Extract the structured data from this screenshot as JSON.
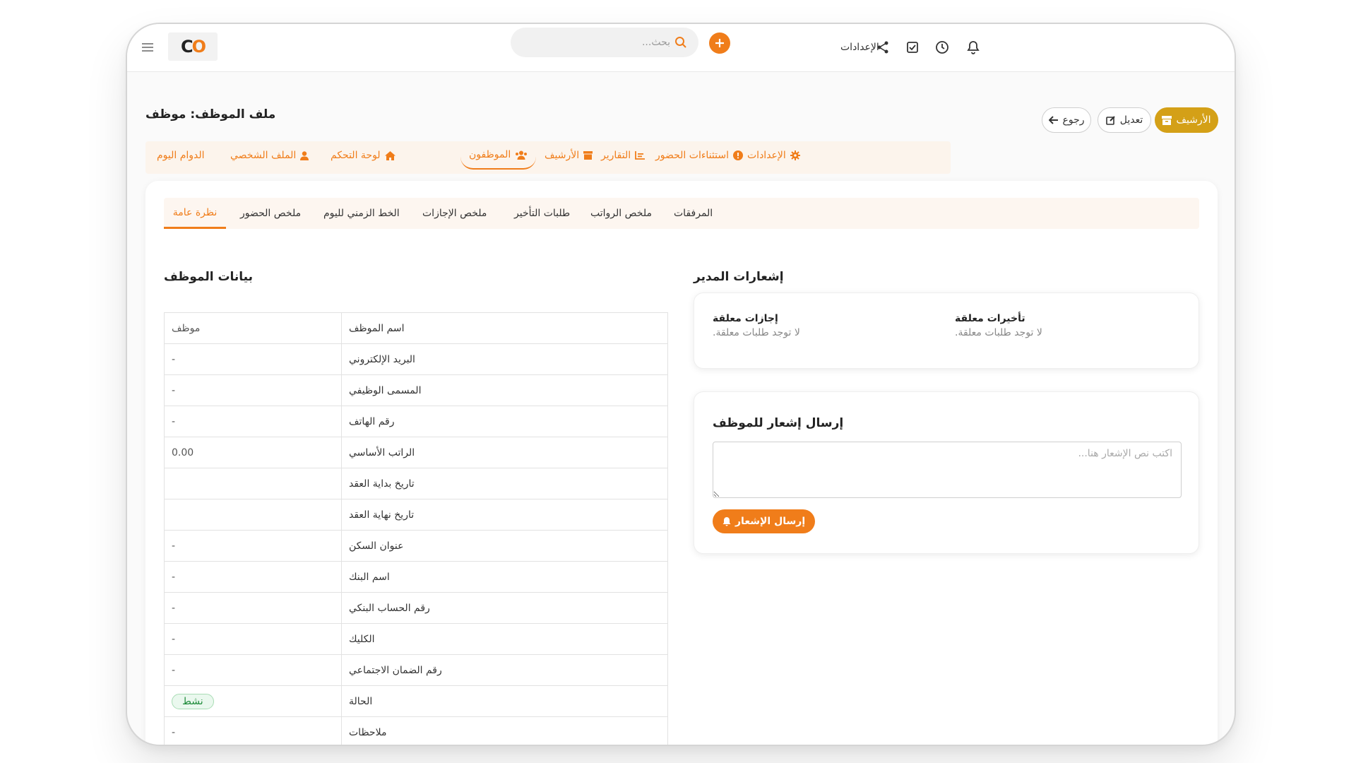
{
  "colors": {
    "accent": "#f07d1a",
    "archive": "#d4a017",
    "status_green": "#1e8b3a"
  },
  "topbar": {
    "logo": "CO",
    "search_placeholder": "بحث...",
    "settings_label": "الإعدادات",
    "icons": [
      "bell-icon",
      "clock-icon",
      "checkbox-icon",
      "share-icon",
      "search-icon",
      "plus-icon",
      "menu-icon"
    ]
  },
  "header": {
    "title": "ملف الموظف: موظف",
    "archive_label": "الأرشيف",
    "edit_label": "تعديل",
    "back_label": "رجوع"
  },
  "mainnav": [
    {
      "label": "الإعدادات",
      "icon": "gear-icon"
    },
    {
      "label": "استثناءات الحضور",
      "icon": "alert-icon"
    },
    {
      "label": "التقارير",
      "icon": "chart-icon"
    },
    {
      "label": "الأرشيف",
      "icon": "archive-icon"
    },
    {
      "label": "الموظفون",
      "icon": "users-icon"
    },
    {
      "label": "لوحة التحكم",
      "icon": "home-icon"
    },
    {
      "label": "الملف الشخصي",
      "icon": "user-icon"
    },
    {
      "label": "الدوام اليوم",
      "icon": ""
    }
  ],
  "subtabs": [
    "المرفقات",
    "ملخص الرواتب",
    "طلبات التأخير",
    "ملخص الإجازات",
    "الخط الزمني لليوم",
    "ملخص الحضور",
    "نظرة عامة"
  ],
  "employee": {
    "section_title": "بيانات الموظف",
    "rows": [
      {
        "label": "اسم الموظف",
        "value": "موظف"
      },
      {
        "label": "البريد الإلكتروني",
        "value": "-"
      },
      {
        "label": "المسمى الوظيفي",
        "value": "-"
      },
      {
        "label": "رقم الهاتف",
        "value": "-"
      },
      {
        "label": "الراتب الأساسي",
        "value": "0.00"
      },
      {
        "label": "تاريخ بداية العقد",
        "value": ""
      },
      {
        "label": "تاريخ نهاية العقد",
        "value": ""
      },
      {
        "label": "عنوان السكن",
        "value": "-"
      },
      {
        "label": "اسم البنك",
        "value": "-"
      },
      {
        "label": "رقم الحساب البنكي",
        "value": "-"
      },
      {
        "label": "الكليك",
        "value": "-"
      },
      {
        "label": "رقم الضمان الاجتماعي",
        "value": "-"
      },
      {
        "label": "الحالة",
        "value": "نشط"
      },
      {
        "label": "ملاحظات",
        "value": "-"
      }
    ]
  },
  "manager": {
    "section_title": "إشعارات المدير",
    "pending_delays_title": "تأخيرات معلقة",
    "pending_delays_text": "لا توجد طلبات معلقة.",
    "pending_leaves_title": "إجازات معلقة",
    "pending_leaves_text": "لا توجد طلبات معلقة."
  },
  "notify": {
    "title": "إرسال إشعار للموظف",
    "placeholder": "اكتب نص الإشعار هنا...",
    "send_label": "إرسال الإشعار"
  }
}
